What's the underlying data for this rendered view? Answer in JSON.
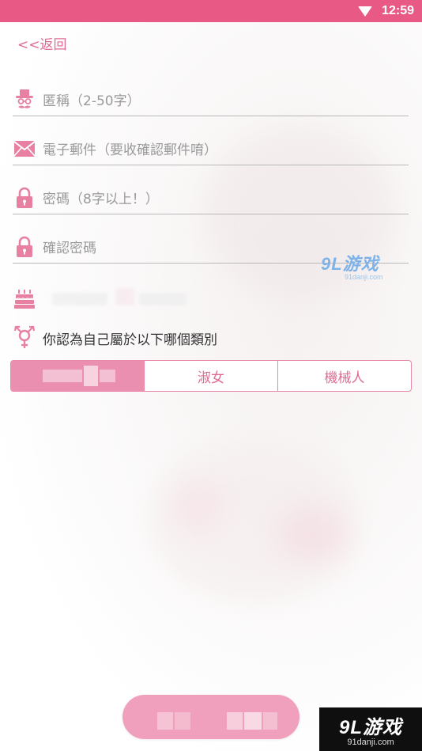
{
  "status_bar": {
    "time": "12:59",
    "bg_color": "#e85a85"
  },
  "nav": {
    "back_label": "<<返回"
  },
  "form": {
    "nickname_placeholder": "匿稱（2-50字）",
    "email_placeholder": "電子郵件（要收確認郵件唷）",
    "password_placeholder": "密碼（8字以上！）",
    "confirm_password_placeholder": "確認密碼",
    "gender_prompt": "你認為自己屬於以下哪個類別",
    "gender_options": [
      "",
      "淑女",
      "機械人"
    ],
    "selected_gender_index": 0,
    "submit_label": ""
  },
  "icons": {
    "nickname": "gentleman-icon",
    "email": "envelope-icon",
    "password": "lock-icon",
    "confirm_password": "lock-icon",
    "birthday": "cake-icon",
    "gender": "gender-symbol-icon"
  },
  "colors": {
    "accent": "#e06a92",
    "segment_active": "#eb8fb0",
    "submit": "#f0a0bc"
  },
  "watermark": {
    "text": "9L游戏",
    "site": "91danji.com"
  }
}
